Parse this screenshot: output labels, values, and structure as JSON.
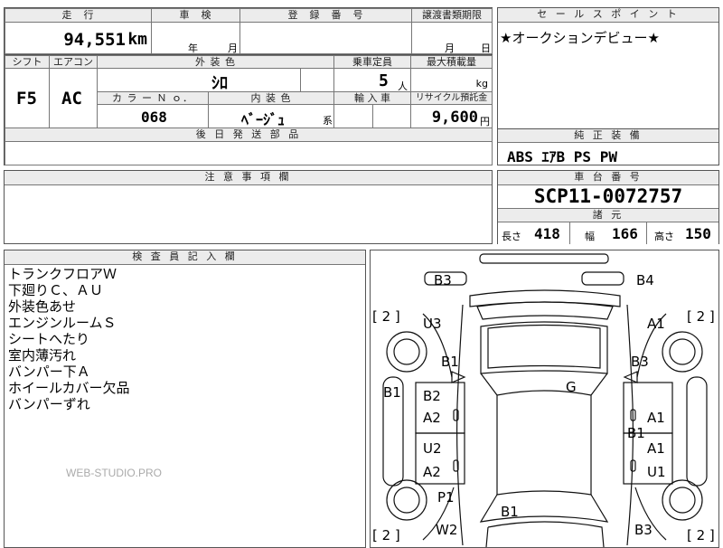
{
  "top": {
    "mileage_label": "走　行",
    "mileage_value": "94,551",
    "mileage_unit": "km",
    "shaken_label": "車　検",
    "shaken_year": "年",
    "shaken_month": "月",
    "registration_label": "登　録　番　号",
    "transfer_label": "譲渡書類期限",
    "transfer_month": "月",
    "transfer_day": "日"
  },
  "second": {
    "shift_label": "シフト",
    "shift_value": "F5",
    "ac_label": "エアコン",
    "ac_value": "AC",
    "exterior_label": "外 装 色",
    "exterior_value": "ｼﾛ",
    "capacity_label": "乗車定員",
    "capacity_value": "5",
    "capacity_unit": "人",
    "load_label": "最大積載量",
    "load_unit": "kg",
    "color_no_label": "カ ラ ー Ｎ ｏ．",
    "color_no_value": "068",
    "interior_label": "内 装 色",
    "interior_value": "ﾍﾞｰｼﾞｭ",
    "interior_suffix": "系",
    "import_label": "輸 入 車",
    "recycle_label": "リサイクル預託金",
    "recycle_value": "9,600",
    "recycle_unit": "円",
    "delivery_label": "後 日 発 送 部 品"
  },
  "sales": {
    "label": "セ ー ル ス ポ イ ン ト",
    "text": "★オークションデビュー★"
  },
  "equipment": {
    "label": "純 正 装 備",
    "items": "ABS ｴｱB PS PW"
  },
  "notes": {
    "label": "注 意 事 項 欄"
  },
  "chassis": {
    "label": "車 台 番 号",
    "value": "SCP11-0072757",
    "spec_label": "諸 元",
    "length_label": "長さ",
    "length_value": "418",
    "width_label": "幅",
    "width_value": "166",
    "height_label": "高さ",
    "height_value": "150"
  },
  "inspector": {
    "label": "検 査 員 記 入 欄",
    "lines": [
      "トランクフロアＷ",
      "下廻りＣ、ＡＵ",
      "外装色あせ",
      "エンジンルームＳ",
      "シートへたり",
      "室内薄汚れ",
      "バンパー下Ａ",
      "ホイールカバー欠品",
      "バンパーずれ"
    ]
  },
  "watermark": "WEB-STUDIO.PRO",
  "diagram": {
    "marks": {
      "b3_tl": "B3",
      "b4_tr": "B4",
      "bracket_l1": "[ 2 ]",
      "bracket_r1": "[ 2 ]",
      "u3": "U3",
      "a1_tr": "A1",
      "b1_l": "B1",
      "b3_r": "B3",
      "b1_side_l": "B1",
      "b2": "B2",
      "g": "G",
      "a2_l1": "A2",
      "a1_r1": "A1",
      "b1_r": "B1",
      "u2": "U2",
      "a1_r2": "A1",
      "a2_l2": "A2",
      "u1": "U1",
      "p1": "P1",
      "b1_bottom": "B1",
      "w2": "W2",
      "b3_br": "B3",
      "bracket_l2": "[ 2 ]",
      "bracket_r2": "[ 2 ]"
    }
  }
}
